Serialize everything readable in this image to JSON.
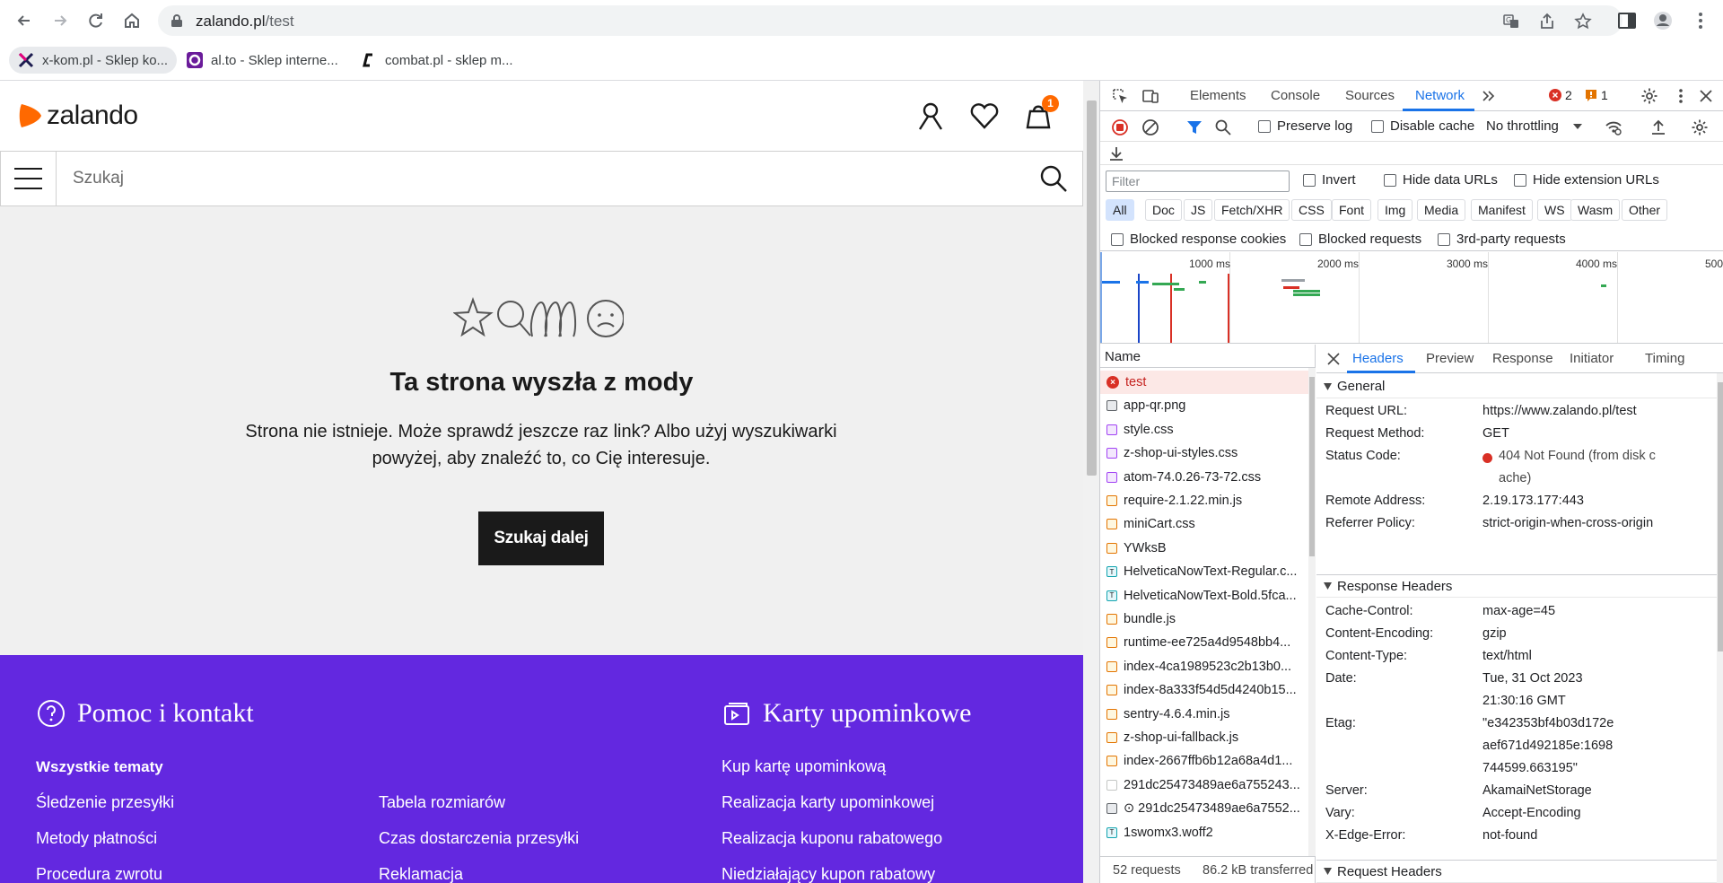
{
  "browser": {
    "url_host": "zalando.pl",
    "url_path": "/test",
    "bookmarks": [
      {
        "label": "x-kom.pl - Sklep ko..."
      },
      {
        "label": "al.to - Sklep interne..."
      },
      {
        "label": "combat.pl - sklep m..."
      }
    ]
  },
  "zalando": {
    "logo_text": "zalando",
    "cart_count": "1",
    "search_placeholder": "Szukaj",
    "notfound": {
      "title": "Ta strona wyszła z mody",
      "text_line1": "Strona nie istnieje. Może sprawdź jeszcze raz link? Albo użyj wyszukiwarki",
      "text_line2": "powyżej, aby znaleźć to, co Cię interesuje.",
      "button": "Szukaj dalej"
    },
    "footer": {
      "help_title": "Pomoc i kontakt",
      "gift_title": "Karty upominkowe",
      "all_topics": "Wszystkie tematy",
      "col1": [
        "Śledzenie przesyłki",
        "Metody płatności",
        "Procedura zwrotu"
      ],
      "col2": [
        "Tabela rozmiarów",
        "Czas dostarczenia przesyłki",
        "Reklamacja"
      ],
      "col3": [
        "Kup kartę upominkową",
        "Realizacja karty upominkowej",
        "Realizacja kuponu rabatowego",
        "Niedziałający kupon rabatowy"
      ]
    }
  },
  "devtools": {
    "tabs": [
      "Elements",
      "Console",
      "Sources",
      "Network"
    ],
    "active_tab": "Network",
    "error_count": "2",
    "warning_count": "1",
    "toolbar": {
      "preserve_log": "Preserve log",
      "disable_cache": "Disable cache",
      "throttling": "No throttling"
    },
    "filter": {
      "placeholder": "Filter",
      "invert": "Invert",
      "hide_data_urls": "Hide data URLs",
      "hide_extension_urls": "Hide extension URLs"
    },
    "types": [
      "All",
      "Doc",
      "JS",
      "Fetch/XHR",
      "CSS",
      "Font",
      "Img",
      "Media",
      "Manifest",
      "WS",
      "Wasm",
      "Other"
    ],
    "blocked": {
      "response_cookies": "Blocked response cookies",
      "requests": "Blocked requests",
      "third_party": "3rd-party requests"
    },
    "overview_labels": [
      "1000 ms",
      "2000 ms",
      "3000 ms",
      "4000 ms",
      "500"
    ],
    "name_header": "Name",
    "requests": [
      {
        "name": "test",
        "type": "err"
      },
      {
        "name": "app-qr.png",
        "type": "img"
      },
      {
        "name": "style.css",
        "type": "css"
      },
      {
        "name": "z-shop-ui-styles.css",
        "type": "css"
      },
      {
        "name": "atom-74.0.26-73-72.css",
        "type": "css"
      },
      {
        "name": "require-2.1.22.min.js",
        "type": "js"
      },
      {
        "name": "miniCart.css",
        "type": "js"
      },
      {
        "name": "YWksB",
        "type": "js"
      },
      {
        "name": "HelveticaNowText-Regular.c...",
        "type": "font"
      },
      {
        "name": "HelveticaNowText-Bold.5fca...",
        "type": "font"
      },
      {
        "name": "bundle.js",
        "type": "js"
      },
      {
        "name": "runtime-ee725a4d9548bb4...",
        "type": "js"
      },
      {
        "name": "index-4ca1989523c2b13b0...",
        "type": "js"
      },
      {
        "name": "index-8a333f54d5d4240b15...",
        "type": "js"
      },
      {
        "name": "sentry-4.6.4.min.js",
        "type": "js"
      },
      {
        "name": "z-shop-ui-fallback.js",
        "type": "js"
      },
      {
        "name": "index-2667ffb6b12a68a4d1...",
        "type": "js"
      },
      {
        "name": "291dc25473489ae6a755243...",
        "type": "blank"
      },
      {
        "name": "⊙ 291dc25473489ae6a7552...",
        "type": "img"
      },
      {
        "name": "1swomx3.woff2",
        "type": "font"
      }
    ],
    "status": {
      "requests": "52 requests",
      "transferred": "86.2 kB transferred"
    },
    "detail_tabs": [
      "Headers",
      "Preview",
      "Response",
      "Initiator",
      "Timing"
    ],
    "general": {
      "title": "General",
      "rows": [
        {
          "k": "Request URL:",
          "v": "https://www.zalando.pl/test"
        },
        {
          "k": "Request Method:",
          "v": "GET"
        },
        {
          "k": "Status Code:",
          "v": "404 Not Found (from disk cache)"
        },
        {
          "k": "Remote Address:",
          "v": "2.19.173.177:443"
        },
        {
          "k": "Referrer Policy:",
          "v": "strict-origin-when-cross-origin"
        }
      ]
    },
    "response_headers": {
      "title": "Response Headers",
      "rows": [
        {
          "k": "Cache-Control:",
          "v": "max-age=45"
        },
        {
          "k": "Content-Encoding:",
          "v": "gzip"
        },
        {
          "k": "Content-Type:",
          "v": "text/html"
        },
        {
          "k": "Date:",
          "v": "Tue, 31 Oct 2023 21:30:16 GMT"
        },
        {
          "k": "Etag:",
          "v": "\"e342353bf4b03d172eaef671d492185e:1698744599.663195\""
        },
        {
          "k": "Server:",
          "v": "AkamaiNetStorage"
        },
        {
          "k": "Vary:",
          "v": "Accept-Encoding"
        },
        {
          "k": "X-Edge-Error:",
          "v": "not-found"
        }
      ]
    },
    "request_headers_title": "Request Headers"
  }
}
